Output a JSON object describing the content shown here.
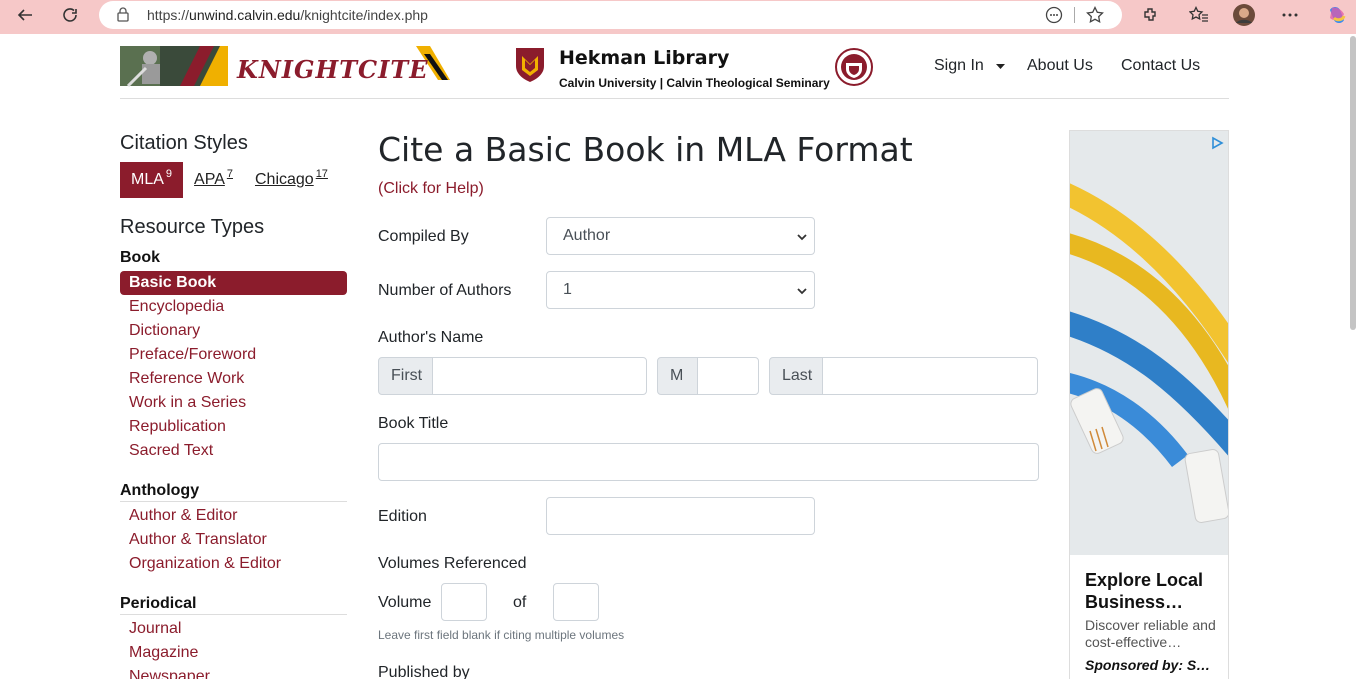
{
  "browser": {
    "url_prefix": "https://",
    "url_host": "unwind.calvin.edu",
    "url_path": "/knightcite/index.php"
  },
  "header": {
    "logo_text": "KNIGHTCITE",
    "library_title": "Hekman Library",
    "library_subtitle": "Calvin University | Calvin Theological Seminary",
    "nav": {
      "sign_in": "Sign In",
      "about": "About Us",
      "contact": "Contact Us"
    }
  },
  "sidebar": {
    "citation_heading": "Citation Styles",
    "styles": [
      {
        "label": "MLA",
        "version": "9"
      },
      {
        "label": "APA",
        "version": "7"
      },
      {
        "label": "Chicago",
        "version": "17"
      }
    ],
    "resource_heading": "Resource Types",
    "groups": [
      {
        "title": "Book",
        "items": [
          "Basic Book",
          "Encyclopedia",
          "Dictionary",
          "Preface/Foreword",
          "Reference Work",
          "Work in a Series",
          "Republication",
          "Sacred Text"
        ]
      },
      {
        "title": "Anthology",
        "items": [
          "Author & Editor",
          "Author & Translator",
          "Organization & Editor"
        ]
      },
      {
        "title": "Periodical",
        "items": [
          "Journal",
          "Magazine",
          "Newspaper"
        ]
      }
    ]
  },
  "main": {
    "title": "Cite a Basic Book in MLA Format",
    "help": "(Click for Help)",
    "compiled_by_label": "Compiled By",
    "compiled_by_value": "Author",
    "num_authors_label": "Number of Authors",
    "num_authors_value": "1",
    "authors_name_label": "Author's Name",
    "first_addon": "First",
    "middle_addon": "M",
    "last_addon": "Last",
    "book_title_label": "Book Title",
    "edition_label": "Edition",
    "volumes_label": "Volumes Referenced",
    "volume_label": "Volume",
    "of_label": "of",
    "volume_note": "Leave first field blank if citing multiple volumes",
    "published_by_label": "Published by"
  },
  "ad": {
    "title": "Explore Local Business…",
    "desc": "Discover reliable and cost-effective…",
    "sponsor": "Sponsored by: S…"
  },
  "colors": {
    "accent": "#8b1c2c",
    "chrome": "#f6c8c8"
  }
}
